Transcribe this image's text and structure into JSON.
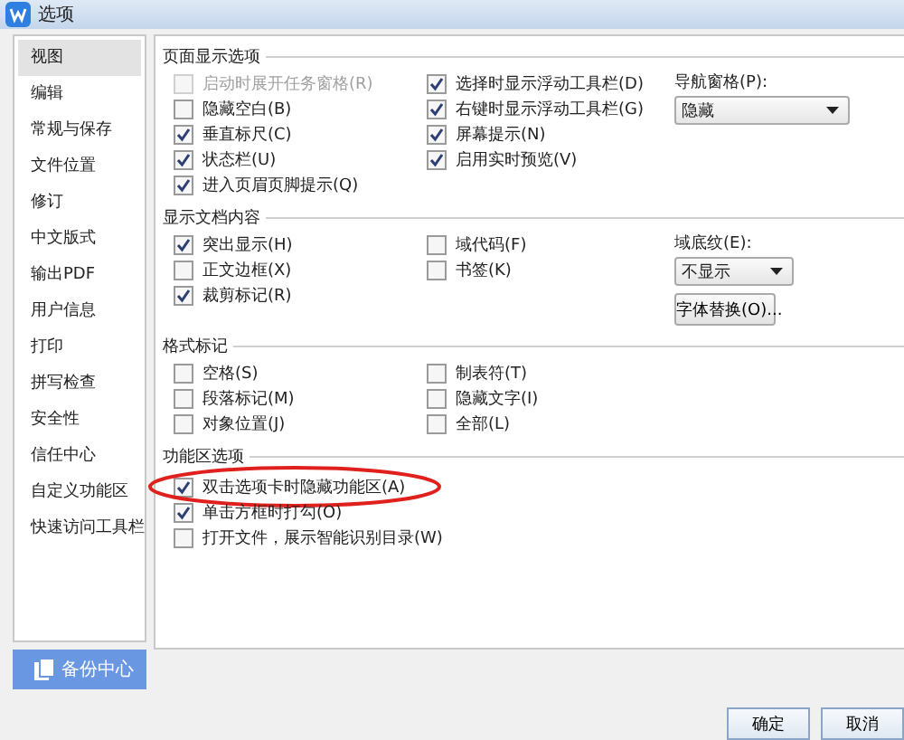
{
  "window": {
    "title": "选项"
  },
  "sidebar": {
    "items": [
      {
        "label": "视图",
        "selected": true
      },
      {
        "label": "编辑",
        "selected": false
      },
      {
        "label": "常规与保存",
        "selected": false
      },
      {
        "label": "文件位置",
        "selected": false
      },
      {
        "label": "修订",
        "selected": false
      },
      {
        "label": "中文版式",
        "selected": false
      },
      {
        "label": "输出PDF",
        "selected": false
      },
      {
        "label": "用户信息",
        "selected": false
      },
      {
        "label": "打印",
        "selected": false
      },
      {
        "label": "拼写检查",
        "selected": false
      },
      {
        "label": "安全性",
        "selected": false
      },
      {
        "label": "信任中心",
        "selected": false
      },
      {
        "label": "自定义功能区",
        "selected": false
      },
      {
        "label": "快速访问工具栏",
        "selected": false
      }
    ]
  },
  "backup_button": {
    "label": "备份中心"
  },
  "sections": [
    {
      "title": "页面显示选项",
      "columns": [
        [
          {
            "kind": "checkbox",
            "label": "启动时展开任务窗格(R)",
            "checked": false,
            "disabled": true
          },
          {
            "kind": "checkbox",
            "label": "隐藏空白(B)",
            "checked": false,
            "disabled": false
          },
          {
            "kind": "checkbox",
            "label": "垂直标尺(C)",
            "checked": true,
            "disabled": false
          },
          {
            "kind": "checkbox",
            "label": "状态栏(U)",
            "checked": true,
            "disabled": false
          },
          {
            "kind": "checkbox",
            "label": "进入页眉页脚提示(Q)",
            "checked": true,
            "disabled": false
          }
        ],
        [
          {
            "kind": "checkbox",
            "label": "选择时显示浮动工具栏(D)",
            "checked": true,
            "disabled": false
          },
          {
            "kind": "checkbox",
            "label": "右键时显示浮动工具栏(G)",
            "checked": true,
            "disabled": false
          },
          {
            "kind": "checkbox",
            "label": "屏幕提示(N)",
            "checked": true,
            "disabled": false
          },
          {
            "kind": "checkbox",
            "label": "启用实时预览(V)",
            "checked": true,
            "disabled": false
          }
        ],
        [
          {
            "kind": "label",
            "label": "导航窗格(P):"
          },
          {
            "kind": "dropdown",
            "value": "隐藏",
            "wide": true
          }
        ]
      ]
    },
    {
      "title": "显示文档内容",
      "columns": [
        [
          {
            "kind": "checkbox",
            "label": "突出显示(H)",
            "checked": true,
            "disabled": false
          },
          {
            "kind": "checkbox",
            "label": "正文边框(X)",
            "checked": false,
            "disabled": false
          },
          {
            "kind": "checkbox",
            "label": "裁剪标记(R)",
            "checked": true,
            "disabled": false
          }
        ],
        [
          {
            "kind": "checkbox",
            "label": "域代码(F)",
            "checked": false,
            "disabled": false
          },
          {
            "kind": "checkbox",
            "label": "书签(K)",
            "checked": false,
            "disabled": false
          }
        ],
        [
          {
            "kind": "label",
            "label": "域底纹(E):"
          },
          {
            "kind": "dropdown",
            "value": "不显示",
            "wide": false
          },
          {
            "kind": "button",
            "label": "字体替换(O)..."
          }
        ]
      ]
    },
    {
      "title": "格式标记",
      "columns": [
        [
          {
            "kind": "checkbox",
            "label": "空格(S)",
            "checked": false,
            "disabled": false
          },
          {
            "kind": "checkbox",
            "label": "段落标记(M)",
            "checked": false,
            "disabled": false
          },
          {
            "kind": "checkbox",
            "label": "对象位置(J)",
            "checked": false,
            "disabled": false
          }
        ],
        [
          {
            "kind": "checkbox",
            "label": "制表符(T)",
            "checked": false,
            "disabled": false
          },
          {
            "kind": "checkbox",
            "label": "隐藏文字(I)",
            "checked": false,
            "disabled": false
          },
          {
            "kind": "checkbox",
            "label": "全部(L)",
            "checked": false,
            "disabled": false
          }
        ]
      ]
    },
    {
      "title": "功能区选项",
      "columns": [
        [
          {
            "kind": "checkbox",
            "label": "双击选项卡时隐藏功能区(A)",
            "checked": true,
            "disabled": false,
            "highlighted": true
          },
          {
            "kind": "checkbox",
            "label": "单击方框时打勾(O)",
            "checked": true,
            "disabled": false
          },
          {
            "kind": "checkbox",
            "label": "打开文件，展示智能识别目录(W)",
            "checked": false,
            "disabled": false
          }
        ]
      ]
    }
  ],
  "buttons": [
    {
      "label": "确定"
    },
    {
      "label": "取消"
    }
  ]
}
